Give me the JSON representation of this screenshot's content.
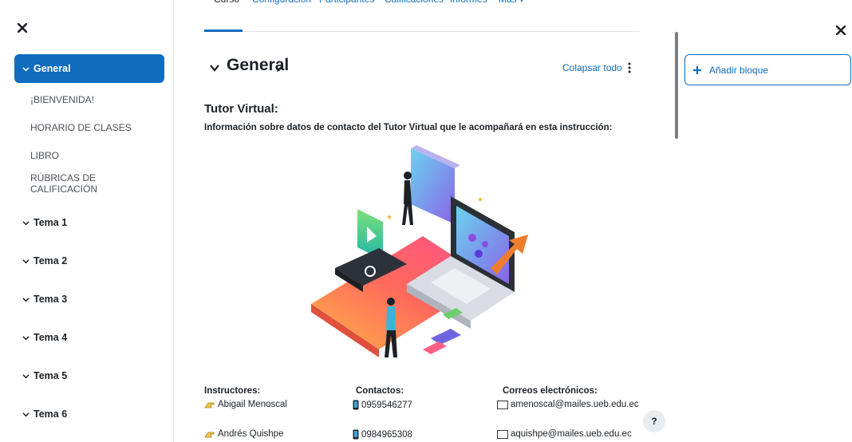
{
  "left_drawer": {
    "close_icon": "close-icon",
    "sections": [
      {
        "label": "General",
        "active": true
      },
      {
        "label": "Tema 1"
      },
      {
        "label": "Tema 2"
      },
      {
        "label": "Tema 3"
      },
      {
        "label": "Tema 4"
      },
      {
        "label": "Tema 5"
      },
      {
        "label": "Tema 6"
      }
    ],
    "general_activities": [
      "¡BIENVENIDA!",
      "HORARIO DE CLASES",
      "LIBRO",
      "RÚBRICAS DE CALIFICACIÓN"
    ]
  },
  "tabs": [
    {
      "label": "Curso",
      "active": true
    },
    {
      "label": "Configuración"
    },
    {
      "label": "Participantes"
    },
    {
      "label": "Calificaciones"
    },
    {
      "label": "Informes"
    },
    {
      "label": "Más ▾"
    }
  ],
  "section": {
    "title": "General",
    "collapse_all": "Colapsar todo",
    "heading": "Tutor Virtual:",
    "description": "Información sobre datos de contacto del Tutor Virtual que le acompañará en esta instrucción:"
  },
  "contacts": {
    "headers": {
      "instructors": "Instructores:",
      "phones": "Contactos:",
      "emails": "Correos electrónicos:"
    },
    "rows": [
      {
        "name": "Abigail Menoscal",
        "phone": "0959546277",
        "email": "amenoscal@mailes.ueb.edu.ec"
      },
      {
        "name": "Andrés Quishpe",
        "phone": "0984965308",
        "email": "aquishpe@mailes.ueb.edu.ec"
      }
    ]
  },
  "help_label": "?",
  "right_drawer": {
    "add_block": "Añadir bloque"
  },
  "colors": {
    "accent": "#0f6cbf",
    "text": "#1d2125",
    "muted": "#4d5156"
  }
}
